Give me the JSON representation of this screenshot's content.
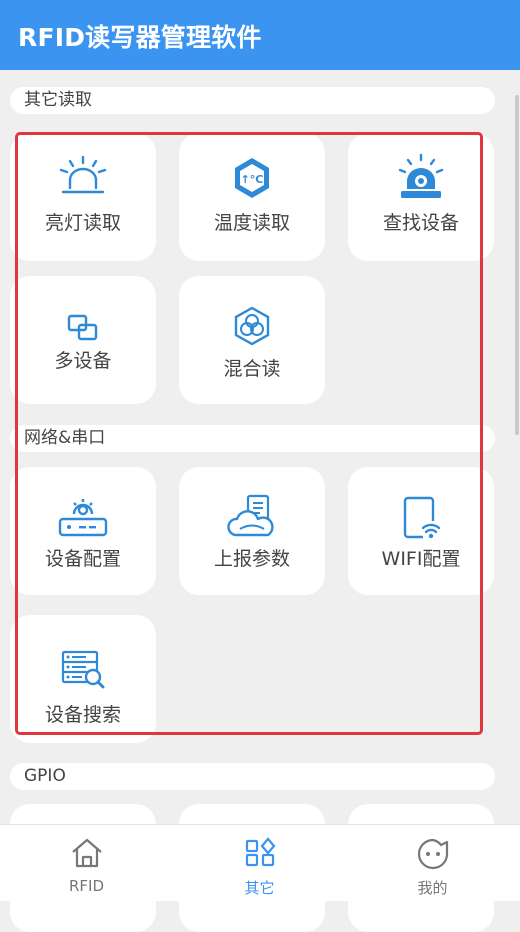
{
  "app": {
    "title": "RFID读写器管理软件"
  },
  "sections": {
    "other_read": {
      "title": "其它读取",
      "tiles": [
        {
          "label": "亮灯读取",
          "icon": "alarm-light-icon"
        },
        {
          "label": "温度读取",
          "icon": "temperature-icon"
        },
        {
          "label": "查找设备",
          "icon": "beacon-icon"
        },
        {
          "label": "多设备",
          "icon": "multi-device-icon"
        },
        {
          "label": "混合读",
          "icon": "mixed-read-icon"
        }
      ]
    },
    "network": {
      "title": "网络&串口",
      "tiles": [
        {
          "label": "设备配置",
          "icon": "router-settings-icon"
        },
        {
          "label": "上报参数",
          "icon": "cloud-report-icon"
        },
        {
          "label": "WIFI配置",
          "icon": "wifi-device-icon"
        },
        {
          "label": "设备搜索",
          "icon": "server-search-icon"
        }
      ]
    },
    "gpio": {
      "title": "GPIO"
    }
  },
  "nav": {
    "active": "其它",
    "items": [
      {
        "label": "RFID",
        "icon": "home-icon"
      },
      {
        "label": "其它",
        "icon": "grid-icon"
      },
      {
        "label": "我的",
        "icon": "face-icon"
      }
    ]
  },
  "colors": {
    "accent": "#3b94f0",
    "icon": "#2e8ad8",
    "highlight": "#e0363f"
  }
}
